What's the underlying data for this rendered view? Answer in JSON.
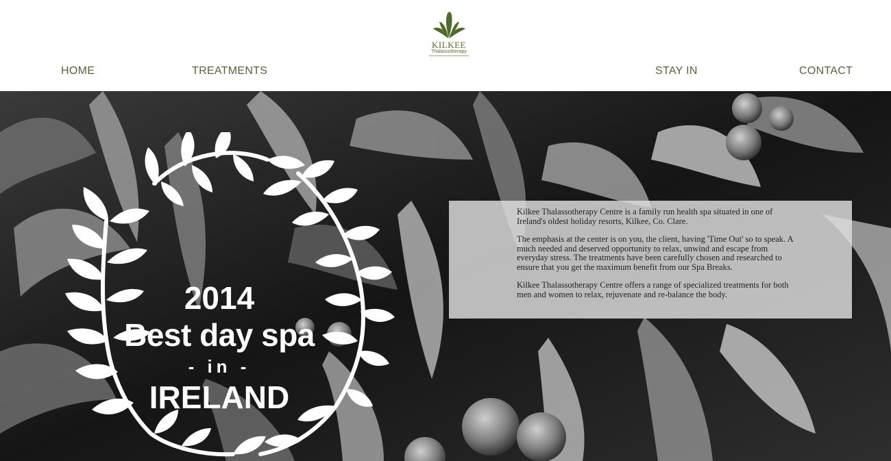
{
  "brand": {
    "name": "KILKEE",
    "subtitle": "Thalassotherapy",
    "logo_icon": "seaweed-plant-icon",
    "color": "#5a6b2a"
  },
  "nav": {
    "home": "HOME",
    "treatments": "TREATMENTS",
    "stay_in": "STAY IN",
    "contact": "CONTACT"
  },
  "award": {
    "year": "2014",
    "title": "Best day spa",
    "in": "- in -",
    "country": "IRELAND",
    "icon": "laurel-wreath-icon"
  },
  "info": {
    "p1": "Kilkee Thalassotherapy Centre is a family run health spa situated in one of Ireland's oldest holiday resorts, Kilkee, Co. Clare.",
    "p2": "The emphasis at the center is on you, the client, having 'Time Out' so to speak. A much needed and deserved opportunity to relax, unwind and escape from everyday stress. The treatments have been carefully chosen and researched to ensure that you get the maximum benefit from our Spa Breaks.",
    "p3": "Kilkee Thalassotherapy Centre offers a range of specialized treatments for both men and women to relax, rejuvenate and re-balance the body."
  },
  "colors": {
    "nav_text": "#5b6139",
    "panel_bg": "#e1e1e1"
  }
}
